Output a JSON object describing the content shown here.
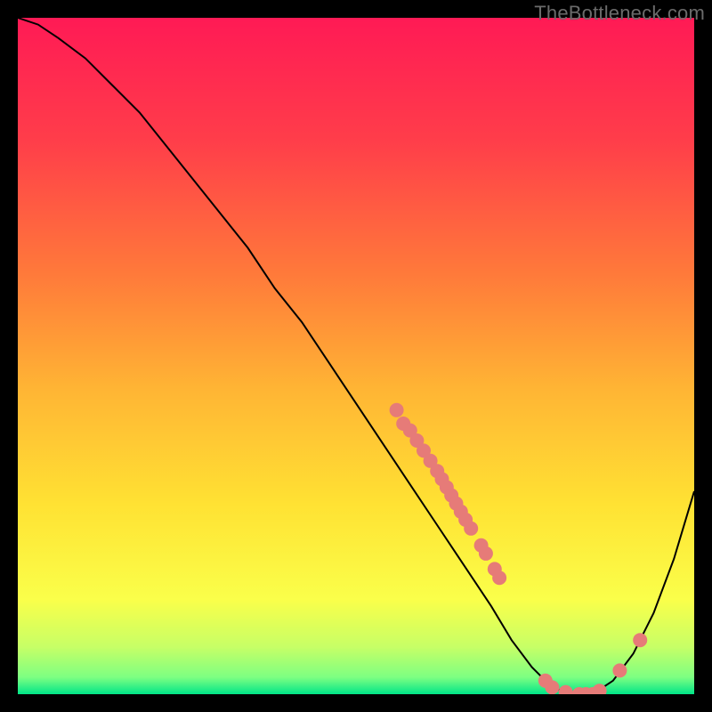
{
  "watermark": "TheBottleneck.com",
  "chart_data": {
    "type": "line",
    "title": "",
    "xlabel": "",
    "ylabel": "",
    "xlim": [
      0,
      100
    ],
    "ylim": [
      0,
      100
    ],
    "grid": false,
    "legend": false,
    "gradient_stops": [
      {
        "offset": 0.0,
        "color": "#ff1a55"
      },
      {
        "offset": 0.18,
        "color": "#ff3d4a"
      },
      {
        "offset": 0.38,
        "color": "#ff7a3a"
      },
      {
        "offset": 0.55,
        "color": "#ffb534"
      },
      {
        "offset": 0.72,
        "color": "#ffe233"
      },
      {
        "offset": 0.86,
        "color": "#faff4a"
      },
      {
        "offset": 0.93,
        "color": "#c7ff66"
      },
      {
        "offset": 0.975,
        "color": "#7dff82"
      },
      {
        "offset": 1.0,
        "color": "#00e588"
      }
    ],
    "series": [
      {
        "name": "bottleneck-curve",
        "color": "#000000",
        "stroke_width": 2,
        "x": [
          0,
          3,
          6,
          10,
          14,
          18,
          22,
          26,
          30,
          34,
          38,
          42,
          46,
          50,
          54,
          58,
          62,
          66,
          70,
          73,
          76,
          79,
          82,
          85,
          88,
          91,
          94,
          97,
          100
        ],
        "y": [
          100,
          99,
          97,
          94,
          90,
          86,
          81,
          76,
          71,
          66,
          60,
          55,
          49,
          43,
          37,
          31,
          25,
          19,
          13,
          8,
          4,
          1,
          0,
          0,
          2,
          6,
          12,
          20,
          30
        ]
      }
    ],
    "markers": {
      "name": "highlight-points",
      "color": "#e67b78",
      "radius": 8,
      "points": [
        {
          "x": 56,
          "y": 42
        },
        {
          "x": 57,
          "y": 40
        },
        {
          "x": 58,
          "y": 39
        },
        {
          "x": 59,
          "y": 37.5
        },
        {
          "x": 60,
          "y": 36
        },
        {
          "x": 61,
          "y": 34.5
        },
        {
          "x": 62,
          "y": 33
        },
        {
          "x": 62.7,
          "y": 31.8
        },
        {
          "x": 63.4,
          "y": 30.6
        },
        {
          "x": 64.1,
          "y": 29.4
        },
        {
          "x": 64.8,
          "y": 28.2
        },
        {
          "x": 65.5,
          "y": 27
        },
        {
          "x": 66.2,
          "y": 25.8
        },
        {
          "x": 67,
          "y": 24.5
        },
        {
          "x": 68.5,
          "y": 22
        },
        {
          "x": 69.2,
          "y": 20.8
        },
        {
          "x": 70.5,
          "y": 18.5
        },
        {
          "x": 71.2,
          "y": 17.2
        },
        {
          "x": 78,
          "y": 2
        },
        {
          "x": 79,
          "y": 1
        },
        {
          "x": 81,
          "y": 0.3
        },
        {
          "x": 83,
          "y": 0
        },
        {
          "x": 84,
          "y": 0
        },
        {
          "x": 85,
          "y": 0
        },
        {
          "x": 86,
          "y": 0.5
        },
        {
          "x": 89,
          "y": 3.5
        },
        {
          "x": 92,
          "y": 8
        }
      ]
    }
  }
}
